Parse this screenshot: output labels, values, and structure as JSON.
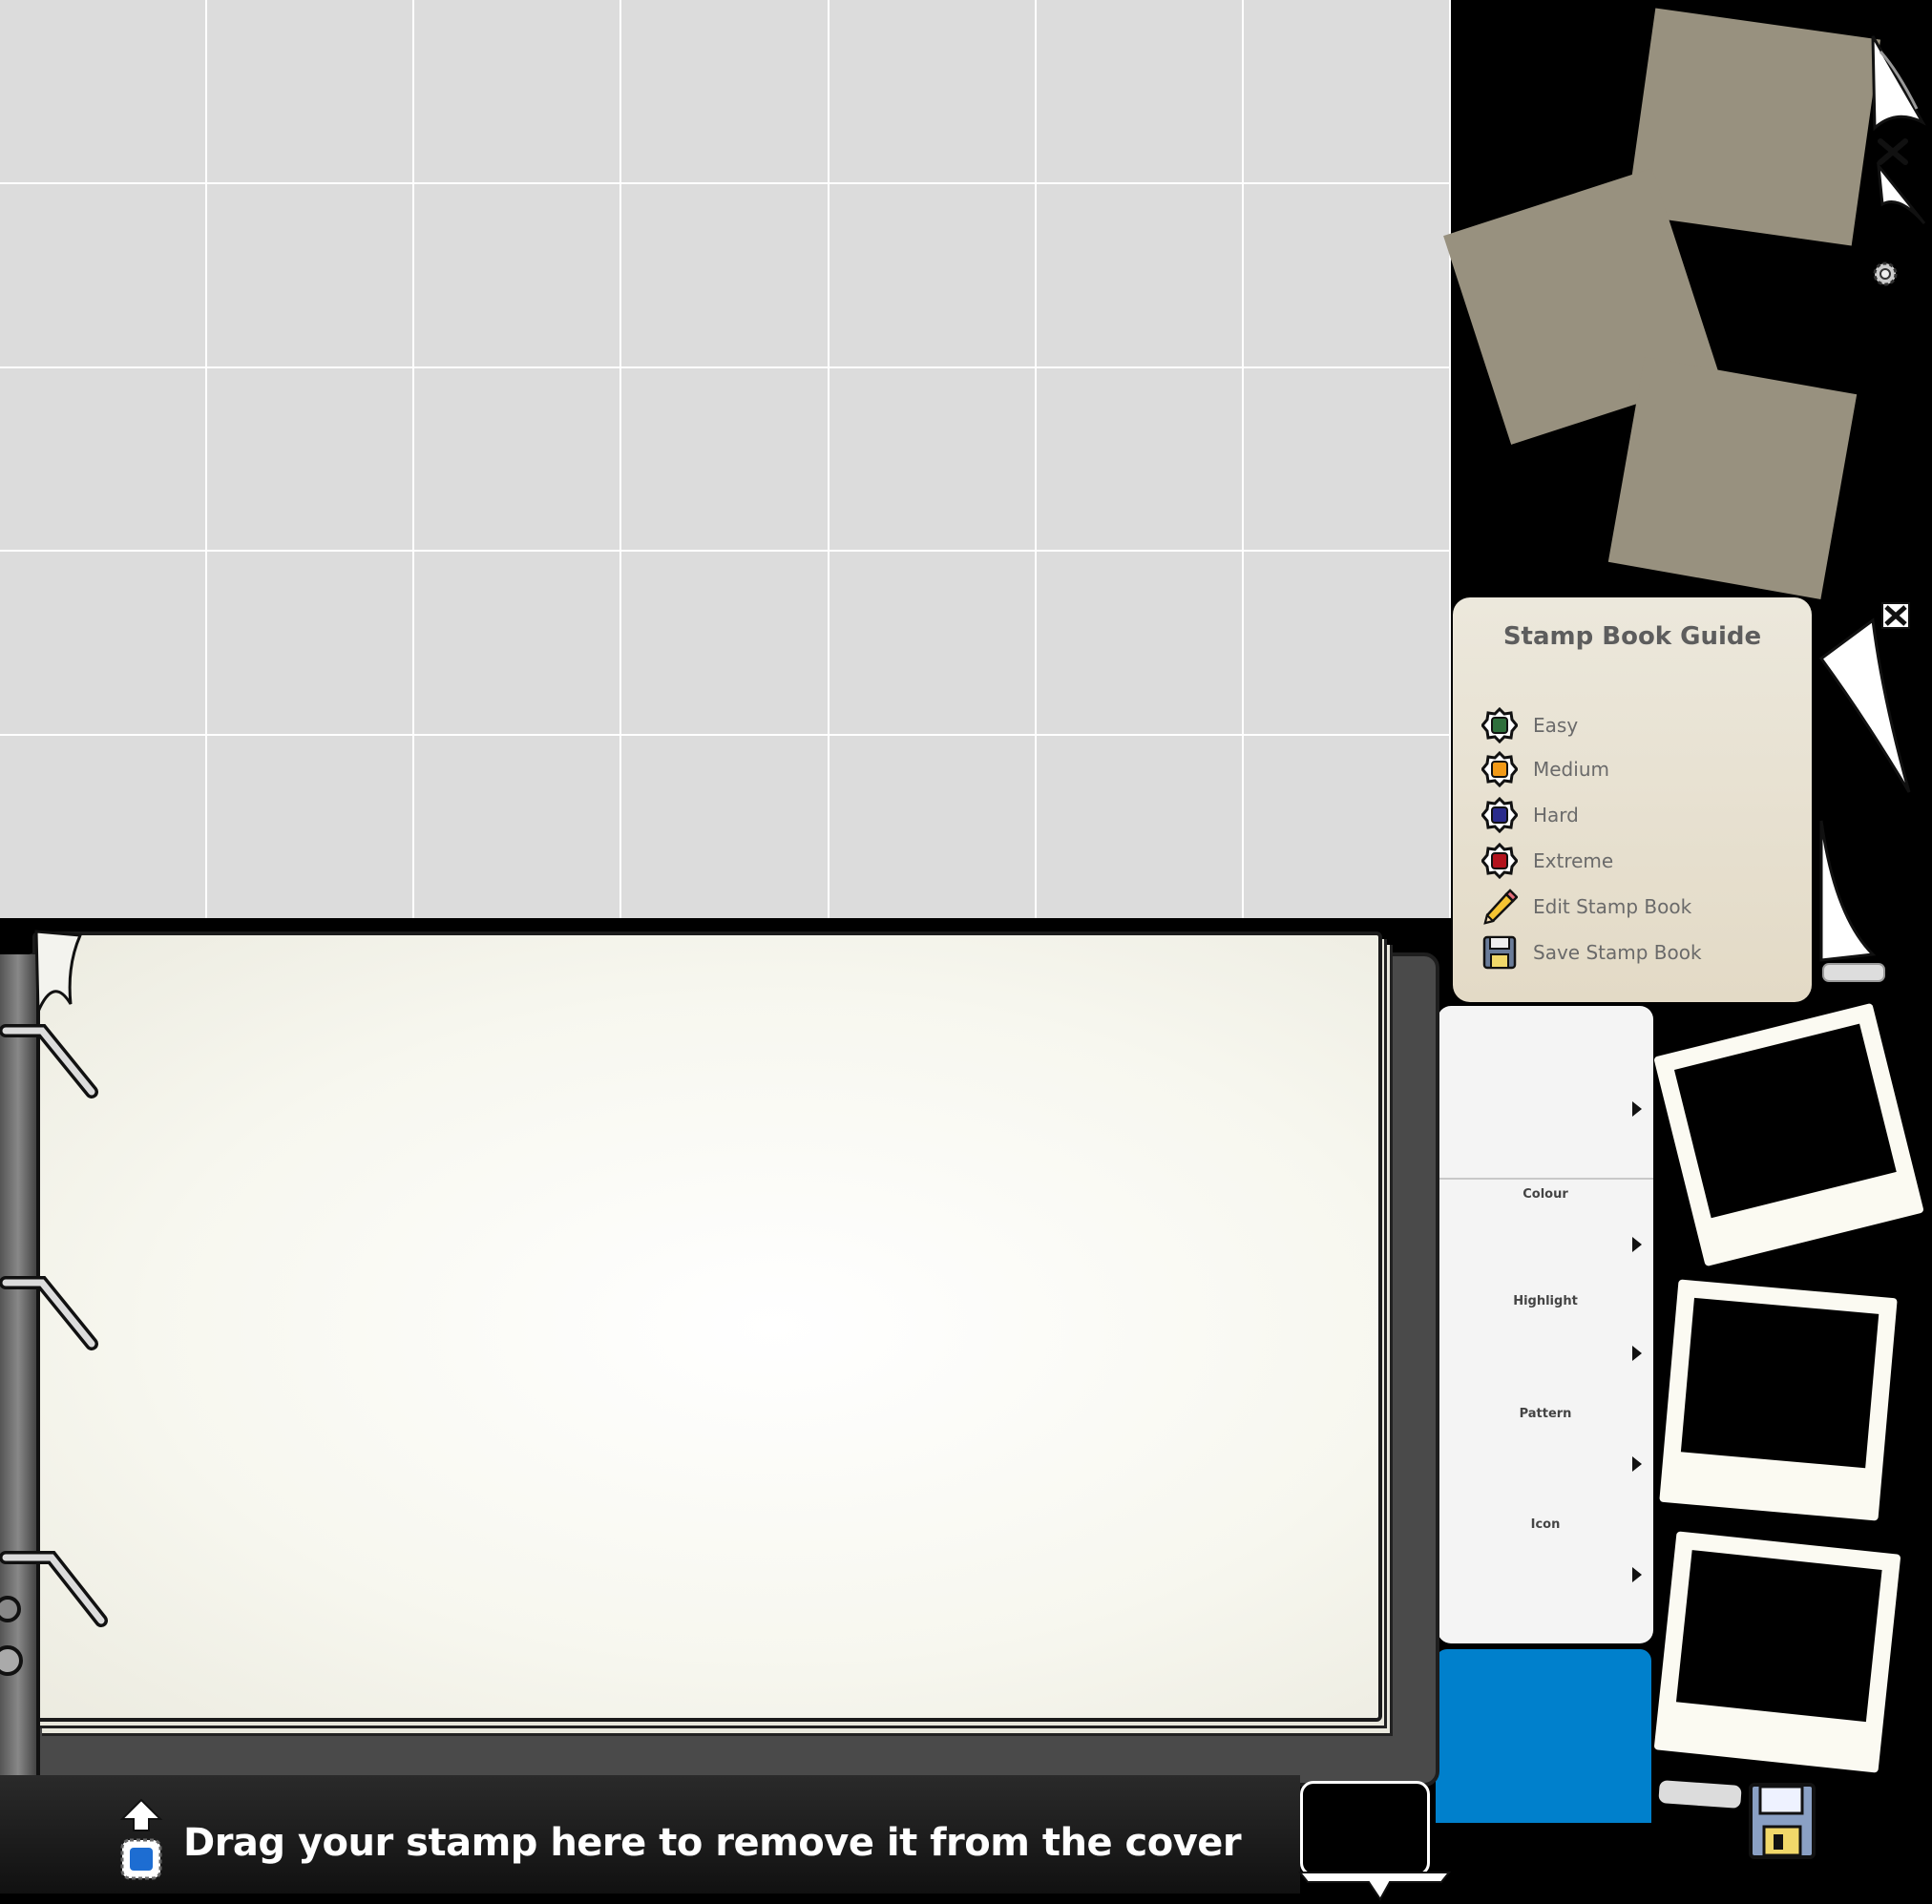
{
  "guide": {
    "title": "Stamp Book Guide",
    "items": [
      {
        "label": "Easy",
        "color": "#2e6f3c",
        "icon": "stamp-easy-icon"
      },
      {
        "label": "Medium",
        "color": "#f29a18",
        "icon": "stamp-medium-icon"
      },
      {
        "label": "Hard",
        "color": "#2a2b8c",
        "icon": "stamp-hard-icon"
      },
      {
        "label": "Extreme",
        "color": "#b3131e",
        "icon": "stamp-extreme-icon"
      },
      {
        "label": "Edit Stamp Book",
        "icon": "pencil-icon"
      },
      {
        "label": "Save Stamp Book",
        "icon": "floppy-disk-icon"
      }
    ]
  },
  "settings": {
    "items": [
      "Colour",
      "Highlight",
      "Pattern",
      "Icon"
    ]
  },
  "drop_zone": {
    "text": "Drag your stamp here to remove it from the cover"
  },
  "colors": {
    "grid_cell": "#dcdcdc",
    "paper": "#98917f",
    "guide_bg": "#e6dfcd",
    "settings_bg": "#f4f4f4",
    "accent_blue": "#0080cc"
  }
}
